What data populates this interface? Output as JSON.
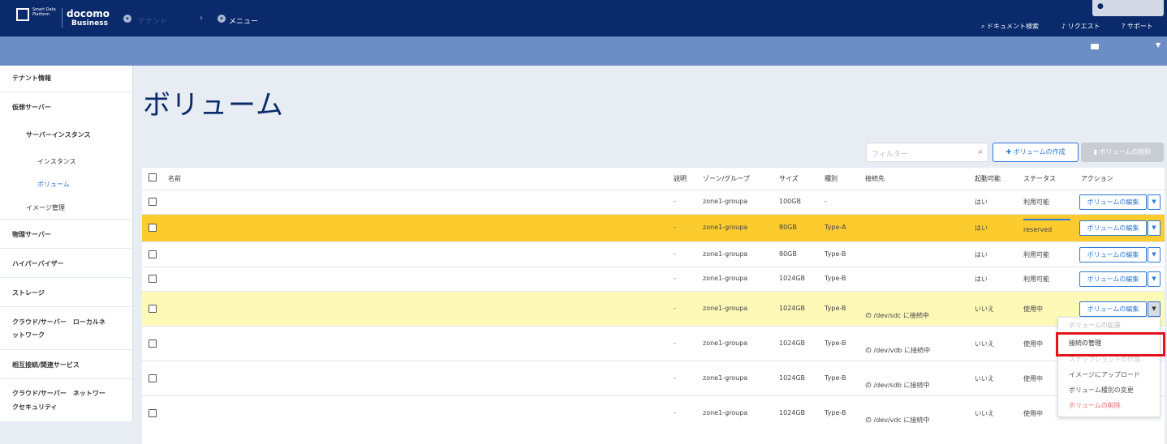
{
  "header": {
    "logo_small": "Smart Data Platform",
    "brand": "docomo",
    "brand_sub": "Business",
    "breadcrumb_faded": "テナント",
    "breadcrumb_current": "メニュー",
    "doc_search": "ドキュメント検索",
    "request": "リクエスト",
    "support": "サポート"
  },
  "sidebar": {
    "tenant": "テナント情報",
    "virtual_server": "仮想サーバー",
    "server_instance": "サーバーインスタンス",
    "instance": "インスタンス",
    "volume": "ボリューム",
    "image": "イメージ管理",
    "physical": "物理サーバー",
    "hypervisor": "ハイパーバイザー",
    "storage": "ストレージ",
    "cloud_local_1": "クラウド/サーバー　ローカルネ",
    "cloud_local_2": "ットワーク",
    "interconnect": "相互接続/関連サービス",
    "cloud_sec_1": "クラウド/サーバー　ネットワー",
    "cloud_sec_2": "クセキュリティ"
  },
  "page": {
    "title": "ボリューム",
    "filter_placeholder": "フィルター",
    "create_label": "ボリュームの作成",
    "delete_label": "ボリュームの削除"
  },
  "table": {
    "headers": {
      "name": "名前",
      "desc": "説明",
      "zone": "ゾーン/グループ",
      "size": "サイズ",
      "type": "種別",
      "conn": "接続先",
      "boot": "起動可能",
      "status": "ステータス",
      "action": "アクション"
    },
    "rows": [
      {
        "desc": "-",
        "zone": "zone1-groupa",
        "size": "100GB",
        "type": "-",
        "conn": "",
        "boot": "はい",
        "status": "利用可能",
        "action": "ボリュームの編集"
      },
      {
        "desc": "-",
        "zone": "zone1-groupa",
        "size": "80GB",
        "type": "Type-A",
        "conn": "",
        "boot": "はい",
        "status": "reserved",
        "action": "ボリュームの編集"
      },
      {
        "desc": "-",
        "zone": "zone1-groupa",
        "size": "80GB",
        "type": "Type-B",
        "conn": "",
        "boot": "はい",
        "status": "利用可能",
        "action": "ボリュームの編集"
      },
      {
        "desc": "-",
        "zone": "zone1-groupa",
        "size": "1024GB",
        "type": "Type-B",
        "conn": "",
        "boot": "はい",
        "status": "利用可能",
        "action": "ボリュームの編集"
      },
      {
        "desc": "-",
        "zone": "zone1-groupa",
        "size": "1024GB",
        "type": "Type-B",
        "conn": "の /dev/sdc に接続中",
        "boot": "いいえ",
        "status": "使用中",
        "action": "ボリュームの編集"
      },
      {
        "desc": "-",
        "zone": "zone1-groupa",
        "size": "1024GB",
        "type": "Type-B",
        "conn": "の /dev/vdb に接続中",
        "boot": "いいえ",
        "status": "使用中",
        "action": ""
      },
      {
        "desc": "-",
        "zone": "zone1-groupa",
        "size": "1024GB",
        "type": "Type-B",
        "conn": "の /dev/sdb に接続中",
        "boot": "いいえ",
        "status": "使用中",
        "action": ""
      },
      {
        "desc": "-",
        "zone": "zone1-groupa",
        "size": "1024GB",
        "type": "Type-B",
        "conn": "の /dev/vdc に接続中",
        "boot": "いいえ",
        "status": "使用中",
        "action": ""
      }
    ]
  },
  "menu": {
    "extend": "ボリュームの拡張",
    "manage_conn": "接続の管理",
    "snapshot": "スナップショットの作成",
    "upload_image": "イメージにアップロード",
    "change_type": "ボリューム種別の変更",
    "delete": "ボリュームの削除"
  }
}
